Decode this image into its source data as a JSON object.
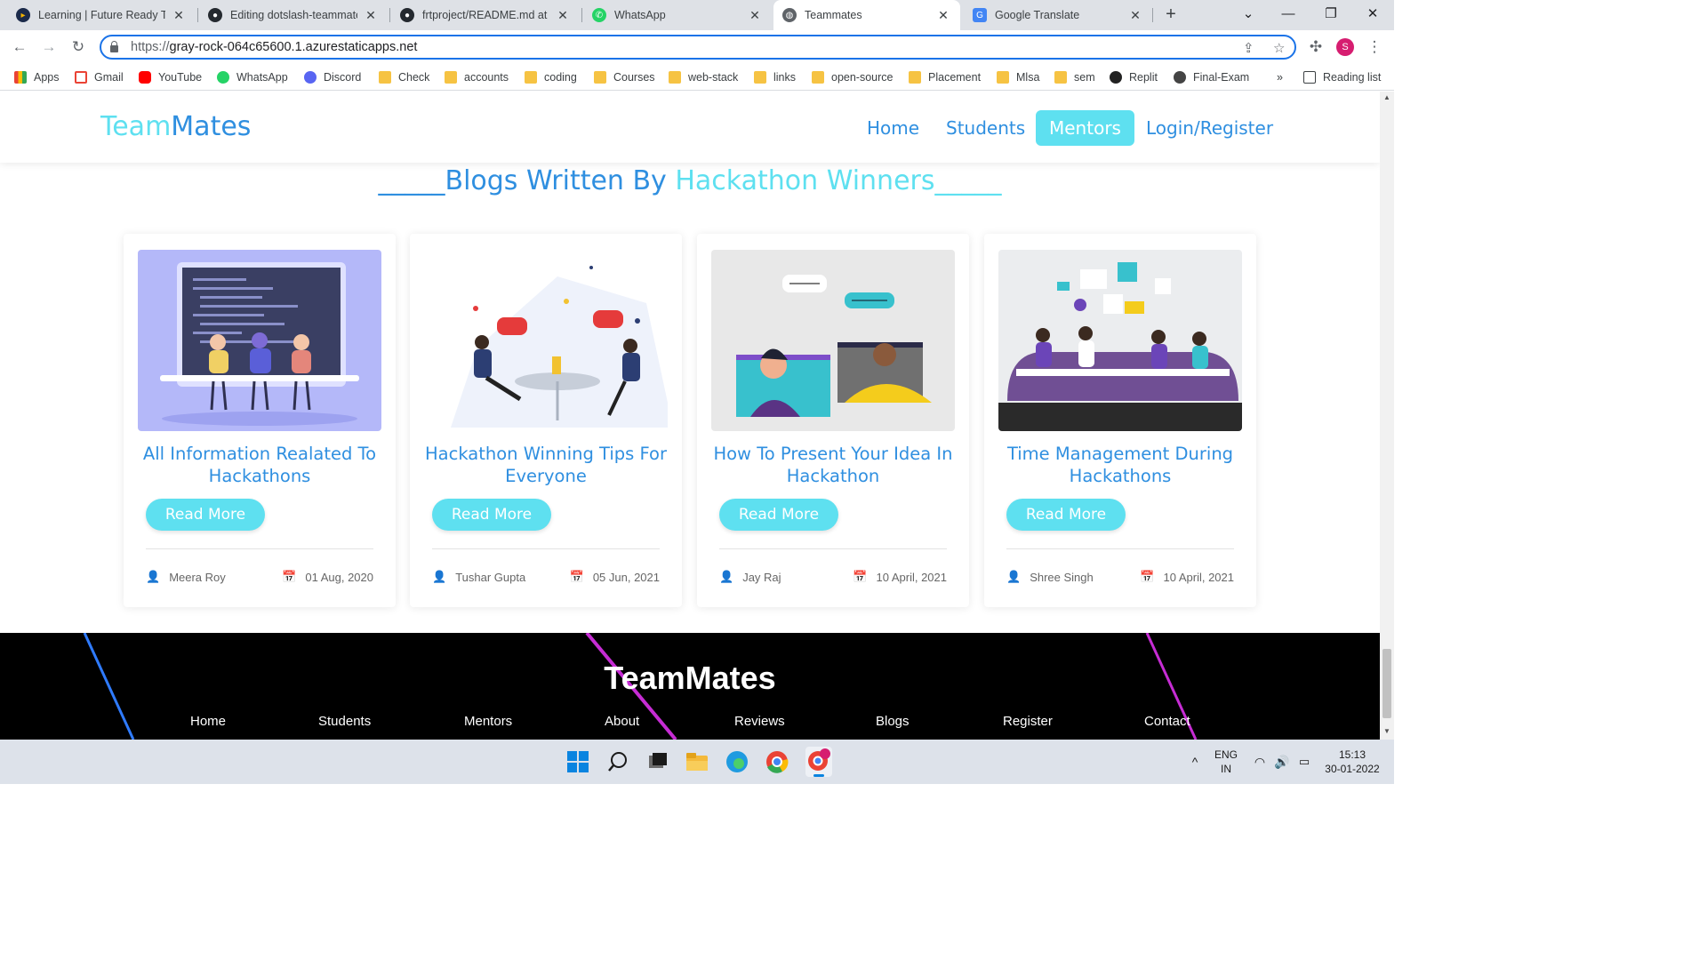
{
  "browser": {
    "tabs": [
      {
        "label": "Learning | Future Ready Tal",
        "close": "✕"
      },
      {
        "label": "Editing dotslash-teammate",
        "close": "✕"
      },
      {
        "label": "frtproject/README.md at m",
        "close": "✕"
      },
      {
        "label": "WhatsApp",
        "close": "✕"
      },
      {
        "label": "Teammates",
        "close": "✕"
      },
      {
        "label": "Google Translate",
        "close": "✕"
      }
    ],
    "new_tab": "+",
    "url_scheme": "https://",
    "url_host": "gray-rock-064c65600.1.azurestaticapps.net",
    "profile_initial": "S",
    "bookmarks": [
      "Apps",
      "Gmail",
      "YouTube",
      "WhatsApp",
      "Discord",
      "Check",
      "accounts",
      "coding",
      "Courses",
      "web-stack",
      "links",
      "open-source",
      "Placement",
      "Mlsa",
      "sem",
      "Replit",
      "Final-Exam"
    ],
    "bookmarks_more": "»",
    "reading_list": "Reading list"
  },
  "site": {
    "logo_part1": "Team",
    "logo_part2": "Mates",
    "nav": {
      "home": "Home",
      "students": "Students",
      "mentors": "Mentors",
      "login": "Login/Register"
    },
    "section_title_part1": "_____Blogs Written By ",
    "section_title_part2": "Hackathon Winners_____",
    "cards": [
      {
        "title": "All Information Realated To Hackathons",
        "button": "Read More",
        "author": "Meera Roy",
        "date": "01 Aug, 2020"
      },
      {
        "title": "Hackathon Winning Tips For Everyone",
        "button": "Read More",
        "author": "Tushar Gupta",
        "date": "05 Jun, 2021"
      },
      {
        "title": "How To Present Your Idea In Hackathon",
        "button": "Read More",
        "author": "Jay Raj",
        "date": "10 April, 2021"
      },
      {
        "title": "Time Management During Hackathons",
        "button": "Read More",
        "author": "Shree Singh",
        "date": "10 April, 2021"
      }
    ],
    "footer": {
      "logo": "TeamMates",
      "links": [
        "Home",
        "Students",
        "Mentors",
        "About",
        "Reviews",
        "Blogs",
        "Register",
        "Contact"
      ]
    }
  },
  "taskbar": {
    "lang_line1": "ENG",
    "lang_line2": "IN",
    "time": "15:13",
    "date": "30-01-2022",
    "chevron": "^"
  },
  "colors": {
    "accent_cyan": "#5ee0f0",
    "accent_blue": "#2f8fe0",
    "footer_bg": "#000000"
  }
}
